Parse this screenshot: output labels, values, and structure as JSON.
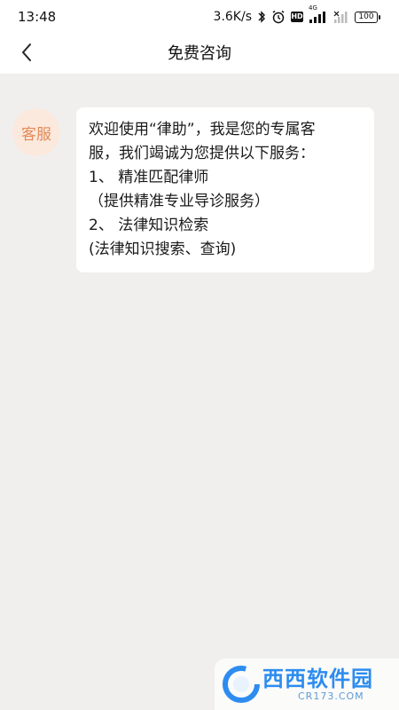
{
  "status_bar": {
    "time": "13:48",
    "network_speed": "3.6K/s",
    "hd_label": "HD",
    "network_type": "4G",
    "battery_level": "100"
  },
  "header": {
    "title": "免费咨询"
  },
  "chat": {
    "avatar_label": "客服",
    "message_lines": [
      "欢迎使用“律助”，我是您的专属客",
      "服，我们竭诚为您提供以下服务：",
      "1、 精准匹配律师",
      "（提供精准专业导诊服务）",
      "2、 法律知识检索",
      "(法律知识搜索、查询)"
    ]
  },
  "watermark": {
    "title": "西西软件园",
    "url": "CR173.COM"
  }
}
